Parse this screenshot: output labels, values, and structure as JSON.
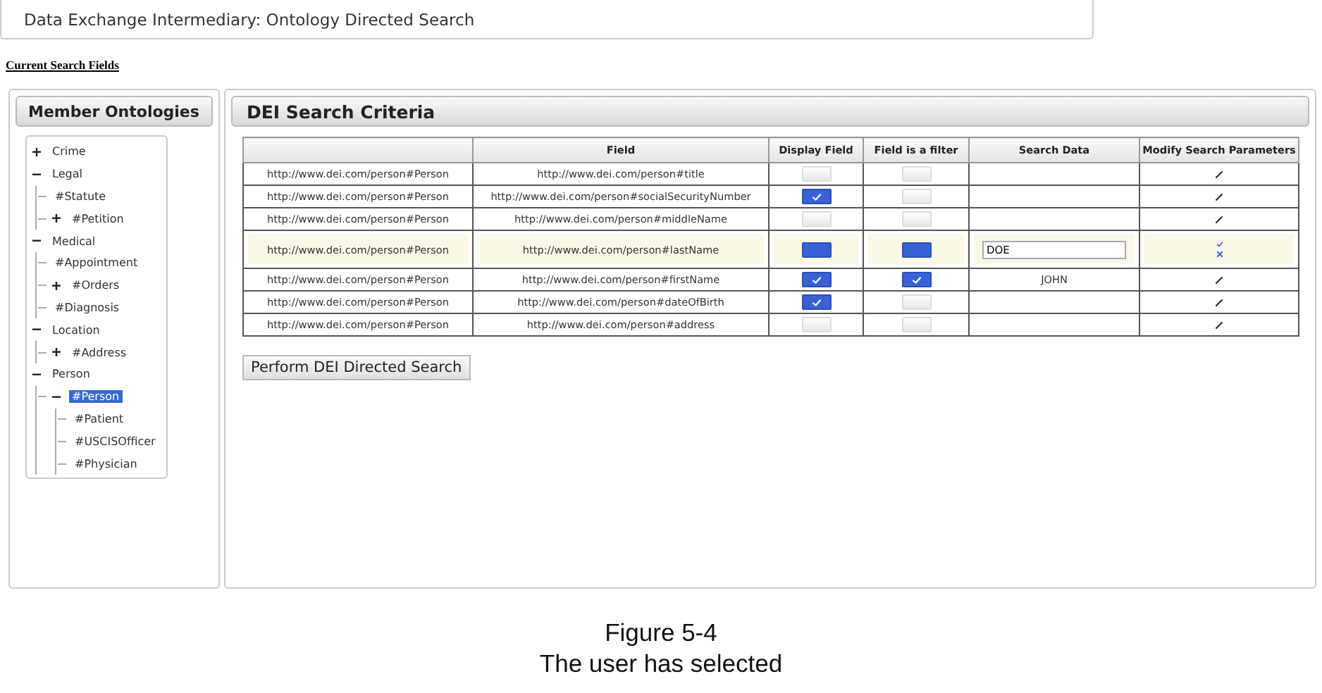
{
  "header": {
    "title": "Data Exchange Intermediary: Ontology Directed Search"
  },
  "section_link": "Current Search Fields",
  "sidebar": {
    "title": "Member Ontologies",
    "tree": [
      {
        "label": "Crime",
        "expanded": false,
        "selected": false
      },
      {
        "label": "Legal",
        "expanded": true,
        "selected": false,
        "children": [
          {
            "label": "#Statute",
            "selected": false
          },
          {
            "label": "#Petition",
            "expanded": false,
            "selected": false
          }
        ]
      },
      {
        "label": "Medical",
        "expanded": true,
        "selected": false,
        "children": [
          {
            "label": "#Appointment",
            "selected": false
          },
          {
            "label": "#Orders",
            "expanded": false,
            "selected": false
          },
          {
            "label": "#Diagnosis",
            "selected": false
          }
        ]
      },
      {
        "label": "Location",
        "expanded": true,
        "selected": false,
        "children": [
          {
            "label": "#Address",
            "expanded": false,
            "selected": false
          }
        ]
      },
      {
        "label": "Person",
        "expanded": true,
        "selected": false,
        "children": [
          {
            "label": "#Person",
            "expanded": true,
            "selected": true,
            "children": [
              {
                "label": "#Patient",
                "selected": false
              },
              {
                "label": "#USCISOfficer",
                "selected": false
              },
              {
                "label": "#Physician",
                "selected": false
              }
            ]
          }
        ]
      }
    ]
  },
  "criteria": {
    "title": "DEI Search Criteria",
    "columns": [
      "Field",
      "Display Field",
      "Field is a filter",
      "Search Data",
      "Modify Search Parameters"
    ],
    "rows": [
      {
        "ontology": "http://www.dei.com/person#Person",
        "field": "http://www.dei.com/person#title",
        "display": false,
        "filter": false,
        "search_data": "",
        "editing": false
      },
      {
        "ontology": "http://www.dei.com/person#Person",
        "field": "http://www.dei.com/person#socialSecurityNumber",
        "display": true,
        "filter": false,
        "search_data": "",
        "editing": false
      },
      {
        "ontology": "http://www.dei.com/person#Person",
        "field": "http://www.dei.com/person#middleName",
        "display": false,
        "filter": false,
        "search_data": "",
        "editing": false
      },
      {
        "ontology": "http://www.dei.com/person#Person",
        "field": "http://www.dei.com/person#lastName",
        "display": true,
        "filter": true,
        "search_data": "DOE",
        "editing": true
      },
      {
        "ontology": "http://www.dei.com/person#Person",
        "field": "http://www.dei.com/person#firstName",
        "display": true,
        "filter": true,
        "search_data": "JOHN",
        "editing": false
      },
      {
        "ontology": "http://www.dei.com/person#Person",
        "field": "http://www.dei.com/person#dateOfBirth",
        "display": true,
        "filter": false,
        "search_data": "",
        "editing": false
      },
      {
        "ontology": "http://www.dei.com/person#Person",
        "field": "http://www.dei.com/person#address",
        "display": false,
        "filter": false,
        "search_data": "",
        "editing": false
      }
    ],
    "search_button": "Perform DEI Directed Search"
  },
  "caption": {
    "figure": "Figure 5-4",
    "text": "The user has selected"
  }
}
